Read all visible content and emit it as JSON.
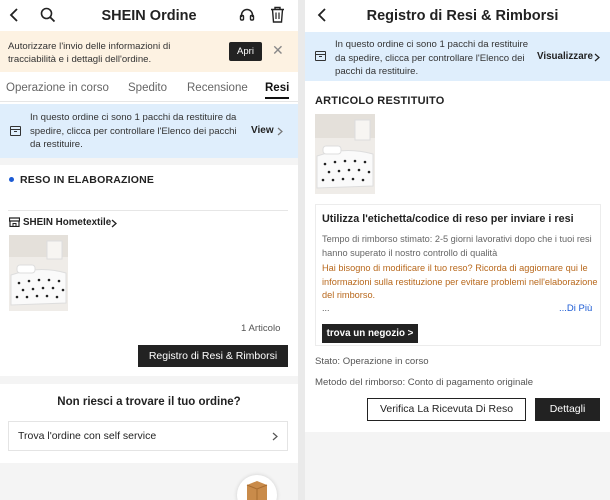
{
  "left": {
    "header": {
      "title": "SHEIN Ordine"
    },
    "notice": {
      "text": "Autorizzare l'invio delle informazioni di tracciabilità e i dettagli dell'ordine.",
      "button": "Apri"
    },
    "tabs": [
      {
        "label": "Operazione in corso"
      },
      {
        "label": "Spedito"
      },
      {
        "label": "Recensione"
      },
      {
        "label": "Resi"
      }
    ],
    "return_notice": {
      "text": "In questo ordine ci sono 1 pacchi da restituire da spedire, clicca per controllare l'Elenco dei pacchi da restituire.",
      "action": "View"
    },
    "status_title": "RESO IN ELABORAZIONE",
    "store": {
      "name": "SHEIN Hometextile"
    },
    "item_count": "1 Articolo",
    "registry_button": "Registro di Resi & Rimborsi",
    "help": {
      "question": "Non riesci a trovare il tuo ordine?",
      "self_service": "Trova l'ordine con self service"
    }
  },
  "right": {
    "header": {
      "title": "Registro di Resi & Rimborsi"
    },
    "return_notice": {
      "text": "In questo ordine ci sono 1 pacchi da restituire da spedire, clicca per controllare l'Elenco dei pacchi da restituire.",
      "action": "Visualizzare"
    },
    "section_title": "ARTICOLO RESTITUITO",
    "card": {
      "title": "Utilizza l'etichetta/codice di reso per inviare i resi",
      "body": "Tempo di rimborso stimato: 2-5 giorni lavorativi dopo che i tuoi resi hanno superato il nostro controllo di qualità",
      "warning": "Hai bisogno di modificare il tuo reso? Ricorda di aggiornare qui le informazioni sulla restituzione per evitare problemi nell'elaborazione del rimborso.",
      "ellipsis": "...",
      "more": "...Di Più",
      "store_button": "trova un negozio >"
    },
    "status": "Stato: Operazione in corso",
    "refund_method": "Metodo del rimborso: Conto di pagamento originale",
    "verify_button": "Verifica La Ricevuta Di Reso",
    "details_button": "Dettagli"
  },
  "colors": {
    "accent_blue": "#1c5bd4",
    "info_bg": "#dfeefc",
    "notice_bg": "#fdf2e2",
    "warning_text": "#b8681c"
  }
}
